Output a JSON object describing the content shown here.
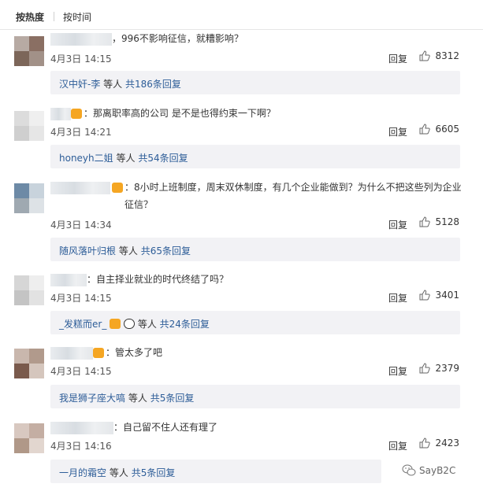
{
  "tabs": {
    "hot": "按热度",
    "time": "按时间"
  },
  "comments": [
    {
      "text": "，996不影响征信，就糟影响？",
      "time": "4月3日 14:15",
      "reply": "回复",
      "likes": "8312",
      "sub": {
        "name": "汉中奸-李",
        "mid": "等人",
        "count": "共186条回复"
      }
    },
    {
      "text": "：那离职率高的公司 是不是也得约束一下啊？",
      "time": "4月3日 14:21",
      "reply": "回复",
      "likes": "6605",
      "sub": {
        "name": "honeyh二姐",
        "mid": "等人",
        "count": "共54条回复"
      }
    },
    {
      "text": "：8小时上班制度，周末双休制度，有几个企业能做到？为什么不把这些列为企业征信？",
      "time": "4月3日 14:34",
      "reply": "回复",
      "likes": "5128",
      "sub": {
        "name": "随风落叶归根",
        "mid": "等人",
        "count": "共65条回复"
      }
    },
    {
      "text": "：自主择业就业的时代终结了吗？",
      "time": "4月3日 14:15",
      "reply": "回复",
      "likes": "3401",
      "sub": {
        "name": "_发糕而er_",
        "mid": "等人",
        "count": "共24条回复"
      }
    },
    {
      "text": "：管太多了吧",
      "time": "4月3日 14:15",
      "reply": "回复",
      "likes": "2379",
      "sub": {
        "name": "我是狮子座大嗃",
        "mid": "等人",
        "count": "共5条回复"
      }
    },
    {
      "text": "：自己留不住人还有理了",
      "time": "4月3日 14:16",
      "reply": "回复",
      "likes": "2423",
      "sub": {
        "name": "一月的霜空",
        "mid": "等人",
        "count": "共5条回复"
      }
    }
  ],
  "watermark": "SayB2C",
  "icons": {
    "like": "thumbs-up-icon",
    "wechat": "wechat-icon"
  }
}
